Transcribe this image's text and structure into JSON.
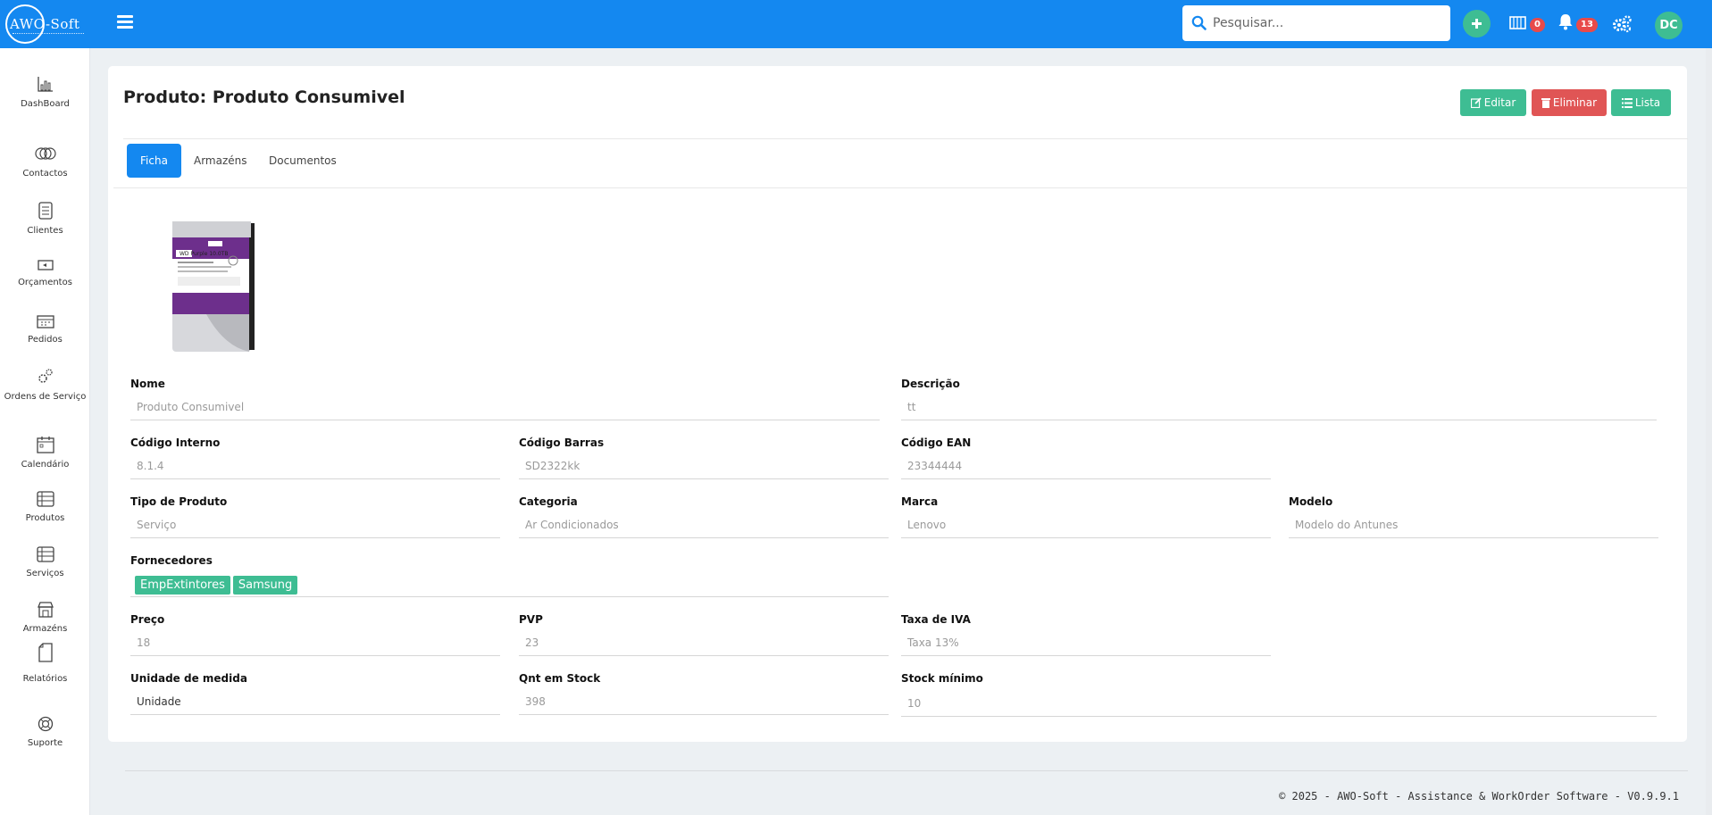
{
  "app": {
    "logo_text": "AWO-Soft",
    "search_placeholder": "Pesquisar...",
    "calendar_badge": "0",
    "notifications_badge": "13",
    "user_initials": "DC"
  },
  "sidebar": {
    "items": [
      {
        "label": "DashBoard",
        "icon": "chart-icon"
      },
      {
        "label": "Contactos",
        "icon": "contacts-icon"
      },
      {
        "label": "Clientes",
        "icon": "clients-icon"
      },
      {
        "label": "Orçamentos",
        "icon": "budget-icon"
      },
      {
        "label": "Pedidos",
        "icon": "orders-icon"
      },
      {
        "label": "Ordens de Serviço",
        "icon": "service-orders-icon"
      },
      {
        "label": "Calendário",
        "icon": "calendar-icon"
      },
      {
        "label": "Produtos",
        "icon": "products-icon"
      },
      {
        "label": "Serviços",
        "icon": "services-icon"
      },
      {
        "label": "Armazéns",
        "icon": "warehouse-icon"
      },
      {
        "label": "Relatórios",
        "icon": "reports-icon"
      },
      {
        "label": "Suporte",
        "icon": "support-icon"
      }
    ]
  },
  "page": {
    "title": "Produto: Produto Consumivel",
    "buttons": {
      "edit": "Editar",
      "delete": "Eliminar",
      "list": "Lista"
    },
    "tabs": [
      "Ficha",
      "Armazéns",
      "Documentos"
    ],
    "product_image_label": "WD Purple 10.0TB"
  },
  "fields": {
    "nome": {
      "label": "Nome",
      "value": "Produto Consumivel"
    },
    "descricao": {
      "label": "Descrição",
      "value": "tt"
    },
    "codigo_interno": {
      "label": "Código Interno",
      "value": "8.1.4"
    },
    "codigo_barras": {
      "label": "Código Barras",
      "value": "SD2322kk"
    },
    "codigo_ean": {
      "label": "Código EAN",
      "value": "23344444"
    },
    "tipo_produto": {
      "label": "Tipo de Produto",
      "value": "Serviço"
    },
    "categoria": {
      "label": "Categoria",
      "value": "Ar Condicionados"
    },
    "marca": {
      "label": "Marca",
      "value": "Lenovo"
    },
    "modelo": {
      "label": "Modelo",
      "value": "Modelo do Antunes"
    },
    "fornecedores": {
      "label": "Fornecedores",
      "tags": [
        "EmpExtintores",
        "Samsung"
      ]
    },
    "preco": {
      "label": "Preço",
      "value": "18"
    },
    "pvp": {
      "label": "PVP",
      "value": "23"
    },
    "taxa_iva": {
      "label": "Taxa de IVA",
      "value": "Taxa 13%"
    },
    "unidade": {
      "label": "Unidade de medida",
      "value": "Unidade"
    },
    "qnt_stock": {
      "label": "Qnt em Stock",
      "value": "398"
    },
    "stock_minimo": {
      "label": "Stock mínimo",
      "value": "10"
    }
  },
  "footer": {
    "text": "© 2025 - AWO-Soft - Assistance & WorkOrder Software - V0.9.9.1"
  },
  "colors": {
    "primary": "#1488f0",
    "success": "#3ebd93",
    "danger": "#e05555"
  }
}
